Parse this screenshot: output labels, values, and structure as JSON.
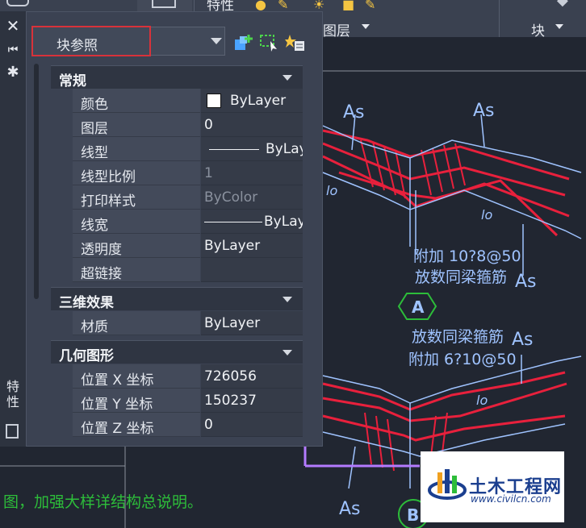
{
  "ribbon": {
    "label_properties": "特性",
    "label_layers": "图层",
    "label_block": "块"
  },
  "sidebar": {
    "vertical_title": "特性"
  },
  "palette": {
    "selector_value": "块参照",
    "sections": {
      "general": "常规",
      "three_d": "三维效果",
      "geometry": "几何图形"
    },
    "rows": {
      "color": {
        "name": "颜色",
        "value": "ByLayer"
      },
      "layer": {
        "name": "图层",
        "value": "0"
      },
      "linetype": {
        "name": "线型",
        "value": "ByLayer"
      },
      "lt_scale": {
        "name": "线型比例",
        "value": "1"
      },
      "plot_style": {
        "name": "打印样式",
        "value": "ByColor"
      },
      "lineweight": {
        "name": "线宽",
        "value": "ByLayer"
      },
      "transparency": {
        "name": "透明度",
        "value": "ByLayer"
      },
      "hyperlink": {
        "name": "超链接",
        "value": ""
      },
      "material": {
        "name": "材质",
        "value": "ByLayer"
      },
      "pos_x": {
        "name": "位置 X 坐标",
        "value": "726056"
      },
      "pos_y": {
        "name": "位置 Y 坐标",
        "value": "150237"
      },
      "pos_z": {
        "name": "位置 Z 坐标",
        "value": "0"
      }
    }
  },
  "drawing": {
    "as_label": "As",
    "lo_label": "lo",
    "note_top_1": "附加 10?8@50",
    "note_top_2": "放数同梁箍筋",
    "note_bot_1": "放数同梁箍筋",
    "note_bot_2": "附加 6?10@50",
    "marker_a": "A",
    "marker_b": "B",
    "bottom_note": "图，加强大样详结构总说明。"
  },
  "watermark": {
    "title": "土木工程网",
    "url": "www.civilcn.com"
  },
  "colors": {
    "accent_red": "#d8323a",
    "rebar_red": "#e8203c",
    "draft_blue": "#9fc3ff",
    "note_green": "#2dbd3a"
  }
}
